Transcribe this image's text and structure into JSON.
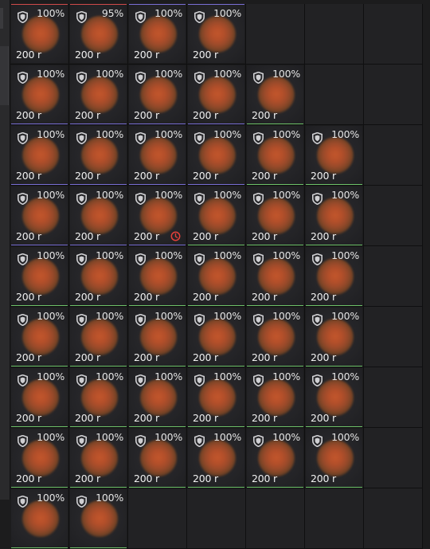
{
  "colors": {
    "blue": "#7a6fd6",
    "green": "#6fc36a",
    "red": "#d04a4a",
    "clock": "#e0403a"
  },
  "icons": {
    "item_badge": "shield-icon",
    "timer": "clock-icon"
  },
  "rows": [
    {
      "cells": [
        {
          "durability": "100%",
          "price": "200 r",
          "rarity": "red"
        },
        {
          "durability": "95%",
          "price": "200 r",
          "rarity": "red"
        },
        {
          "durability": "100%",
          "price": "200 r",
          "rarity": "blue"
        },
        {
          "durability": "100%",
          "price": "200 r",
          "rarity": "blue"
        },
        null,
        null,
        null
      ]
    },
    {
      "cells": [
        {
          "durability": "100%",
          "price": "200 r",
          "rarity": "blue"
        },
        {
          "durability": "100%",
          "price": "200 r",
          "rarity": "blue"
        },
        {
          "durability": "100%",
          "price": "200 r",
          "rarity": "blue"
        },
        {
          "durability": "100%",
          "price": "200 r",
          "rarity": "blue"
        },
        {
          "durability": "100%",
          "price": "200 r",
          "rarity": "green"
        },
        null,
        null
      ]
    },
    {
      "cells": [
        {
          "durability": "100%",
          "price": "200 r",
          "rarity": "blue"
        },
        {
          "durability": "100%",
          "price": "200 r",
          "rarity": "blue"
        },
        {
          "durability": "100%",
          "price": "200 r",
          "rarity": "blue"
        },
        {
          "durability": "100%",
          "price": "200 r",
          "rarity": "blue"
        },
        {
          "durability": "100%",
          "price": "200 r",
          "rarity": "green"
        },
        {
          "durability": "100%",
          "price": "200 r",
          "rarity": "green"
        },
        null
      ]
    },
    {
      "cells": [
        {
          "durability": "100%",
          "price": "200 r",
          "rarity": "blue"
        },
        {
          "durability": "100%",
          "price": "200 r",
          "rarity": "blue"
        },
        {
          "durability": "100%",
          "price": "200 r",
          "rarity": "blue",
          "timer": true
        },
        {
          "durability": "100%",
          "price": "200 r",
          "rarity": "green"
        },
        {
          "durability": "100%",
          "price": "200 r",
          "rarity": "green"
        },
        {
          "durability": "100%",
          "price": "200 r",
          "rarity": "green"
        },
        null
      ]
    },
    {
      "cells": [
        {
          "durability": "100%",
          "price": "200 r",
          "rarity": "green"
        },
        {
          "durability": "100%",
          "price": "200 r",
          "rarity": "green"
        },
        {
          "durability": "100%",
          "price": "200 r",
          "rarity": "green"
        },
        {
          "durability": "100%",
          "price": "200 r",
          "rarity": "green"
        },
        {
          "durability": "100%",
          "price": "200 r",
          "rarity": "green"
        },
        {
          "durability": "100%",
          "price": "200 r",
          "rarity": "green"
        },
        null
      ]
    },
    {
      "cells": [
        {
          "durability": "100%",
          "price": "200 r",
          "rarity": "green"
        },
        {
          "durability": "100%",
          "price": "200 r",
          "rarity": "green"
        },
        {
          "durability": "100%",
          "price": "200 r",
          "rarity": "green"
        },
        {
          "durability": "100%",
          "price": "200 r",
          "rarity": "green"
        },
        {
          "durability": "100%",
          "price": "200 r",
          "rarity": "green"
        },
        {
          "durability": "100%",
          "price": "200 r",
          "rarity": "green"
        },
        null
      ]
    },
    {
      "cells": [
        {
          "durability": "100%",
          "price": "200 r",
          "rarity": "green"
        },
        {
          "durability": "100%",
          "price": "200 r",
          "rarity": "green"
        },
        {
          "durability": "100%",
          "price": "200 r",
          "rarity": "green"
        },
        {
          "durability": "100%",
          "price": "200 r",
          "rarity": "green"
        },
        {
          "durability": "100%",
          "price": "200 r",
          "rarity": "green"
        },
        {
          "durability": "100%",
          "price": "200 r",
          "rarity": "green"
        },
        null
      ]
    },
    {
      "cells": [
        {
          "durability": "100%",
          "price": "200 r",
          "rarity": "green"
        },
        {
          "durability": "100%",
          "price": "200 r",
          "rarity": "green"
        },
        {
          "durability": "100%",
          "price": "200 r",
          "rarity": "green"
        },
        {
          "durability": "100%",
          "price": "200 r",
          "rarity": "green"
        },
        {
          "durability": "100%",
          "price": "200 r",
          "rarity": "green"
        },
        {
          "durability": "100%",
          "price": "200 r",
          "rarity": "green"
        },
        null
      ]
    },
    {
      "cells": [
        {
          "durability": "100%",
          "price": "",
          "rarity": "green"
        },
        {
          "durability": "100%",
          "price": "",
          "rarity": "green"
        },
        null,
        null,
        null,
        null,
        null
      ]
    }
  ]
}
